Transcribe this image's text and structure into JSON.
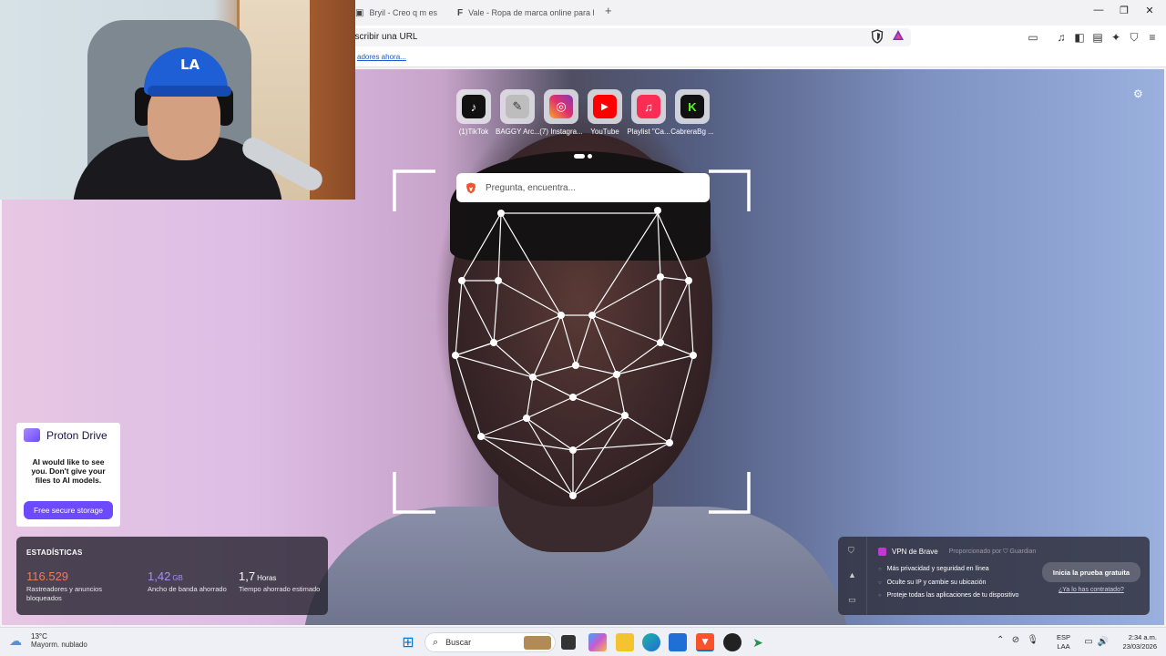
{
  "tabs": [
    {
      "title": "Bryil - Creo q m estoy e",
      "favicon": "capcut-icon"
    },
    {
      "title": "Vale - Ropa de marca online para ho",
      "favicon": "brand-f-icon"
    }
  ],
  "address_bar": {
    "placeholder": "escribir una URL"
  },
  "bookmarks_bar": {
    "link": "adores ahora..."
  },
  "shortcuts": [
    {
      "label": "(1)TikTok",
      "icon": "tiktok-icon",
      "color": "#111111",
      "glyph": "♪"
    },
    {
      "label": "BAGGY Arc...",
      "icon": "baggy-logo-icon",
      "color": "#bdbdbd",
      "glyph": "✎"
    },
    {
      "label": "(7) Instagra...",
      "icon": "instagram-icon",
      "color": "#c13584",
      "glyph": "◎"
    },
    {
      "label": "YouTube",
      "icon": "youtube-icon",
      "color": "#ff0000",
      "glyph": "▶"
    },
    {
      "label": "Playlist \"Ca...",
      "icon": "music-icon",
      "color": "#fa2d55",
      "glyph": "♫"
    },
    {
      "label": "CabreraBg ...",
      "icon": "kick-icon",
      "color": "#111111",
      "glyph": "K"
    }
  ],
  "search": {
    "placeholder": "Pregunta, encuentra..."
  },
  "proton_ad": {
    "brand": "Proton Drive",
    "message": "AI would like to see you. Don't give your files to AI models.",
    "cta": "Free secure storage"
  },
  "stats": {
    "title": "ESTADÍSTICAS",
    "items": [
      {
        "value": "116.529",
        "unit": "",
        "label": "Rastreadores y anuncios bloqueados",
        "color": "#f27a54"
      },
      {
        "value": "1,42",
        "unit": "GB",
        "label": "Ancho de banda ahorrado",
        "color": "#a590f2"
      },
      {
        "value": "1,7",
        "unit": "Horas",
        "label": "Tiempo ahorrado estimado",
        "color": "#ffffff"
      }
    ]
  },
  "vpn": {
    "title": "VPN de Brave",
    "provider": "Proporcionado por ⛉ Guardian",
    "features": [
      "Más privacidad y seguridad en línea",
      "Oculte su IP y cambie su ubicación",
      "Proteje todas las aplicaciones de tu dispositivo"
    ],
    "cta": "Inicia la prueba gratuita",
    "already": "¿Ya lo has contratado?"
  },
  "taskbar": {
    "temperature": "13°C",
    "weather": "Mayorm. nublado",
    "search_label": "Buscar",
    "lang_top": "ESP",
    "lang_bottom": "LAA",
    "time": "2:34 a.m.",
    "date": "23/03/2026"
  },
  "webcam": {
    "cap_logo": "LA"
  }
}
